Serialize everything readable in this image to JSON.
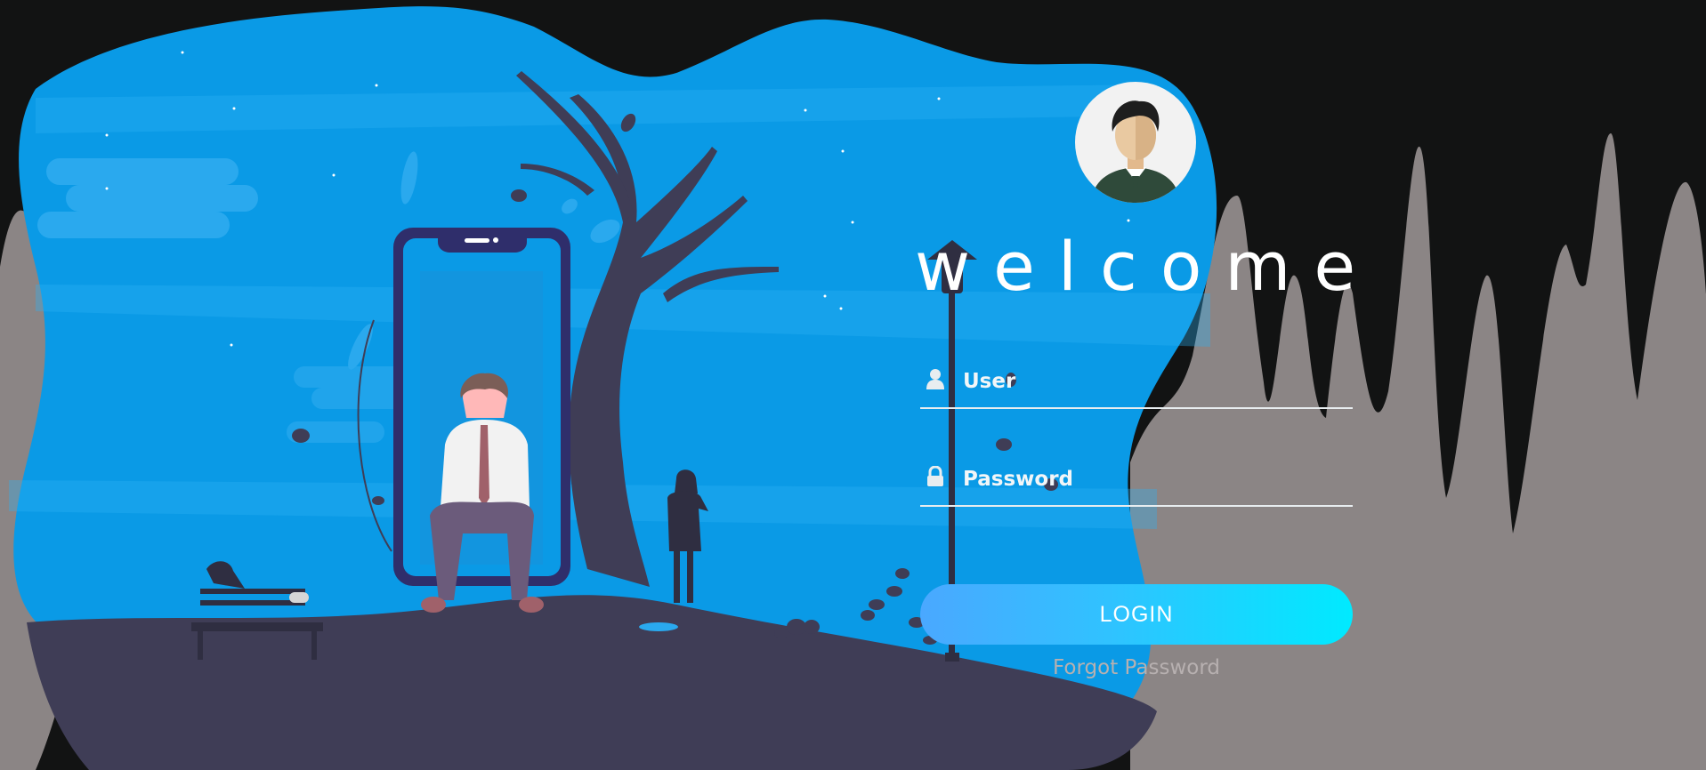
{
  "login": {
    "title": "welcome",
    "user_placeholder": "User",
    "password_placeholder": "Password",
    "login_label": "LOGIN",
    "forgot_label": "Forgot Password"
  },
  "icons": {
    "user": "user-icon",
    "password": "lock-icon",
    "avatar": "avatar-icon"
  },
  "colors": {
    "background": "#121313",
    "hills": "#8b8585",
    "blob": "#0a9ae6",
    "ground": "#3f3d56",
    "button_start": "#4aa8ff",
    "button_end": "#00eaff",
    "forgot_text": "#b7b0b0"
  }
}
